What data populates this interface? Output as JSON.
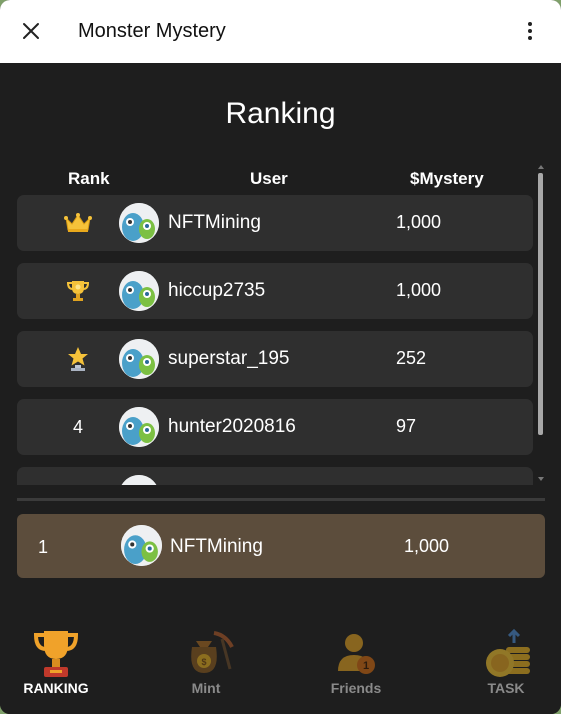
{
  "window": {
    "title": "Monster Mystery"
  },
  "page": {
    "heading": "Ranking"
  },
  "table": {
    "headers": {
      "rank": "Rank",
      "user": "User",
      "mystery": "$Mystery"
    },
    "rows": [
      {
        "rank_icon": "crown-icon",
        "user": "NFTMining",
        "score": "1,000"
      },
      {
        "rank_icon": "trophy-icon",
        "user": "hiccup2735",
        "score": "1,000"
      },
      {
        "rank_icon": "star-trophy-icon",
        "user": "superstar_195",
        "score": "252"
      },
      {
        "rank": "4",
        "user": "hunter2020816",
        "score": "97"
      },
      {
        "rank": "",
        "user": "",
        "score": ""
      }
    ]
  },
  "me": {
    "rank": "1",
    "user": "NFTMining",
    "score": "1,000"
  },
  "nav": {
    "items": [
      {
        "label": "RANKING",
        "icon": "trophy-icon",
        "active": true
      },
      {
        "label": "Mint",
        "icon": "money-bag-pickaxe-icon",
        "active": false
      },
      {
        "label": "Friends",
        "icon": "friends-icon",
        "active": false
      },
      {
        "label": "TASK",
        "icon": "coins-stack-icon",
        "active": false
      }
    ]
  },
  "colors": {
    "background": "#1e1e1e",
    "row": "#2f2f2f",
    "highlight": "#5c4d3c",
    "gold": "#f2b32a"
  }
}
